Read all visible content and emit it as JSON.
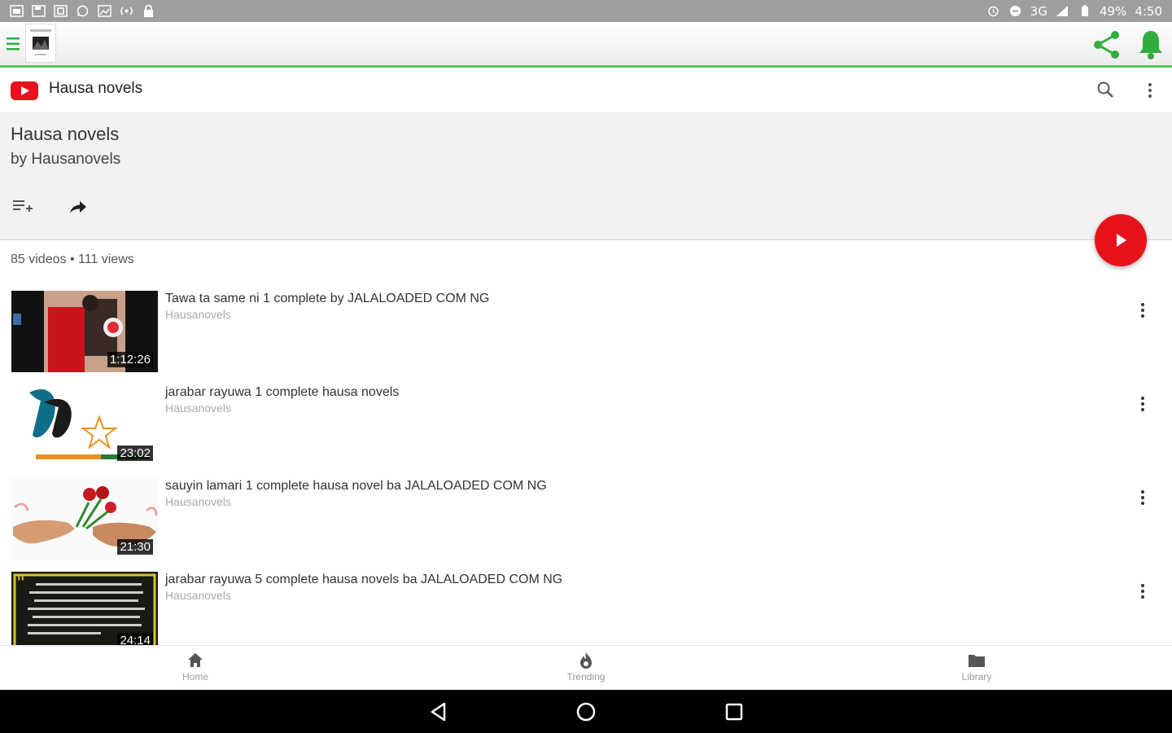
{
  "status_bar": {
    "left_icons": [
      "sim-icon",
      "save-icon",
      "screenshot-icon",
      "whatsapp-icon",
      "image-icon",
      "hotspot-icon",
      "lock-icon"
    ],
    "right_icons": [
      "alarm-icon",
      "circle-icon"
    ],
    "network": "3G",
    "battery": "49%",
    "time": "4:50"
  },
  "app_bar": {
    "icons": [
      "hamburger-icon",
      "app-logo",
      "share-icon",
      "bell-icon"
    ],
    "accent_color": "#2fae3f"
  },
  "yt_header": {
    "title": "Hausa novels",
    "brand_color": "#e8121c"
  },
  "playlist": {
    "title": "Hausa novels",
    "author": "by Hausanovels",
    "meta": "85 videos • 111 views"
  },
  "videos": [
    {
      "title": "Tawa ta same ni 1 complete by JALALOADED COM NG",
      "channel": "Hausanovels",
      "duration": "1:12:26"
    },
    {
      "title": "jarabar rayuwa 1 complete hausa novels",
      "channel": "Hausanovels",
      "duration": "23:02"
    },
    {
      "title": "sauyin lamari 1 complete hausa novel ba JALALOADED COM NG",
      "channel": "Hausanovels",
      "duration": "21:30"
    },
    {
      "title": "jarabar rayuwa 5 complete hausa novels ba JALALOADED COM NG",
      "channel": "Hausanovels",
      "duration": "24:14"
    }
  ],
  "bottom_nav": {
    "items": [
      {
        "label": "Home",
        "icon": "home-icon"
      },
      {
        "label": "Trending",
        "icon": "flame-icon"
      },
      {
        "label": "Library",
        "icon": "folder-icon"
      }
    ]
  },
  "system_nav": {
    "icons": [
      "back-icon",
      "home-circle-icon",
      "recents-icon"
    ]
  }
}
